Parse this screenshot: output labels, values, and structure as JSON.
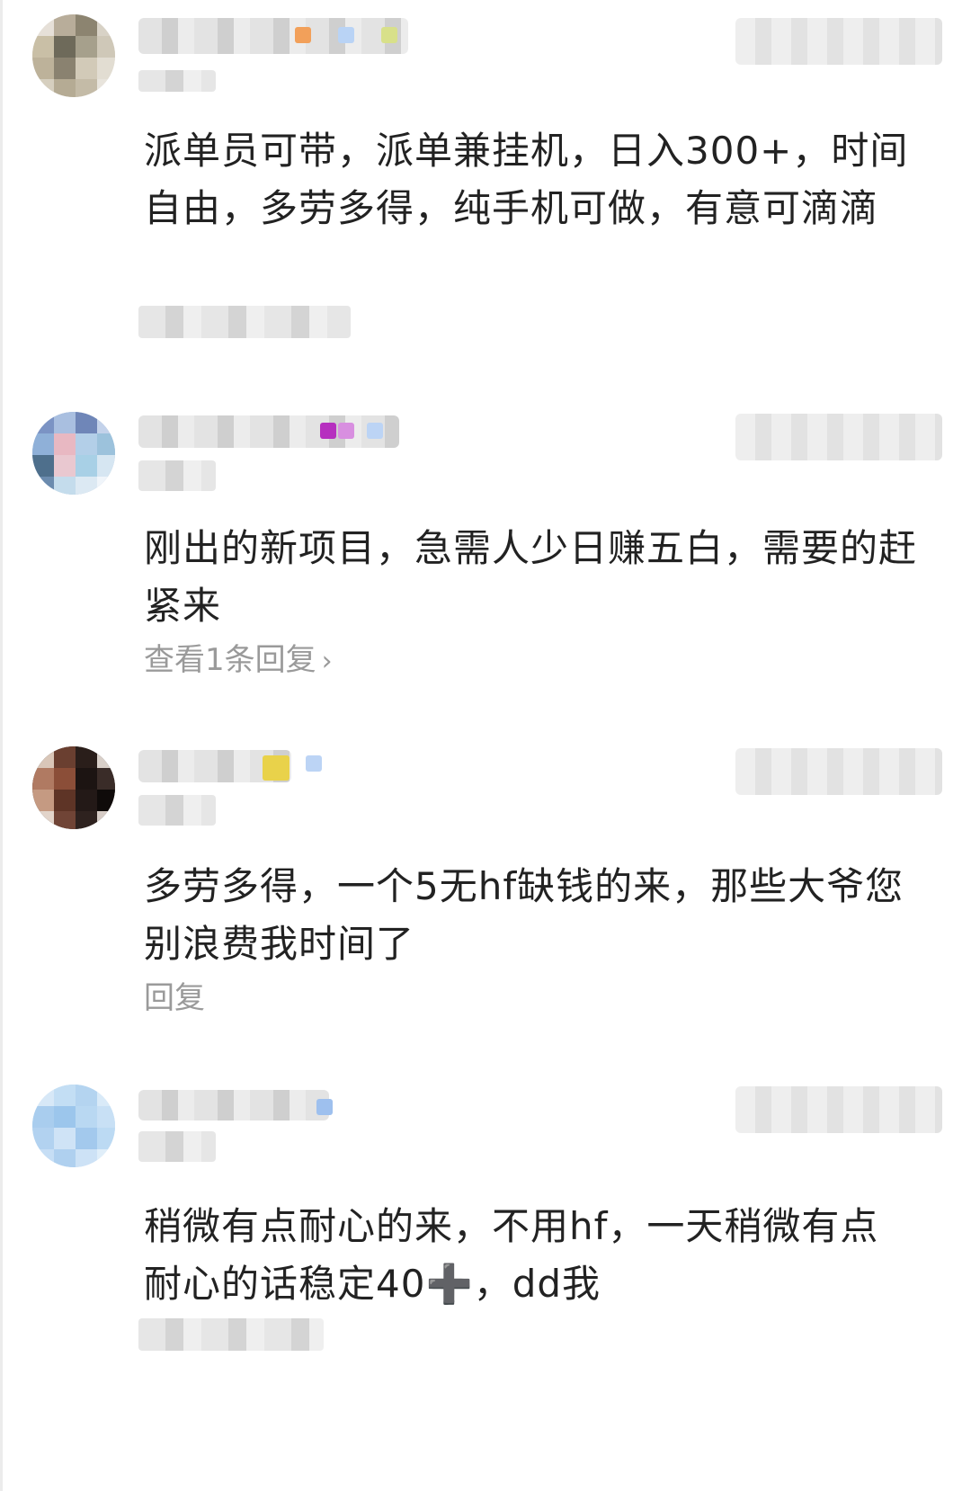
{
  "comments": [
    {
      "text": "派单员可带，派单兼挂机，日入300+，时间自由，多劳多得，纯手机可做，有意可滴滴",
      "reply_link": ""
    },
    {
      "text": "刚出的新项目，急需人少日赚五白，需要的赶紧来",
      "reply_link": "查看1条回复",
      "chevron": "›"
    },
    {
      "text": "多劳多得，一个5无hf缺钱的来，那些大爷您别浪费我时间了",
      "reply_link": "回复"
    },
    {
      "text": "稍微有点耐心的来，不用hf，一天稍微有点耐心的话稳定40➕，dd我",
      "reply_link": ""
    }
  ],
  "icons": {
    "avatar": "user-avatar-icon",
    "reply_chevron": "chevron-right-icon"
  },
  "colors": {
    "text": "#222222",
    "secondary_text": "#9a9a9a",
    "background": "#ffffff"
  }
}
